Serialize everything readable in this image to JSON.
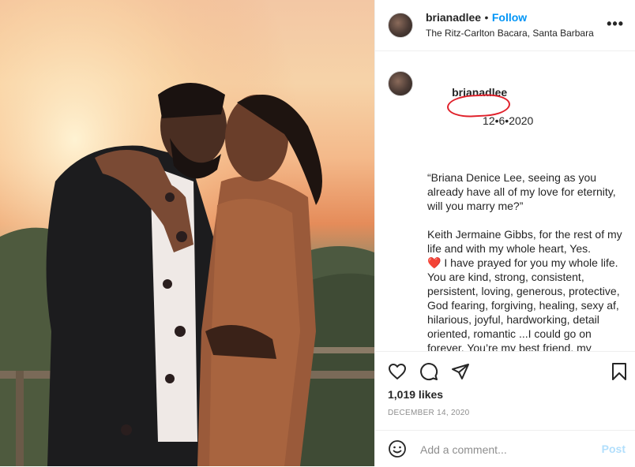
{
  "post": {
    "username": "brianadlee",
    "follow_label": "Follow",
    "separator": "•",
    "location": "The Ritz-Carlton Bacara, Santa Barbara",
    "more_icon": "more-horizontal-icon"
  },
  "caption": {
    "username": "brianadlee",
    "date_text": "12•6•2020",
    "quote": "“Briana Denice Lee, seeing as you already have all of my love for eternity, will you marry me?”",
    "body_pre_heart": "Keith Jermaine Gibbs, for the rest of my life and with my whole heart, Yes.",
    "heart_emoji": "❤️",
    "body_post_heart": " I have prayed for you my whole life. You are kind, strong, consistent, persistent, loving, generous, protective, God fearing, forgiving, healing, sexy af, hilarious, joyful, hardworking, detail oriented, romantic ...I could go on forever. You’re my best friend, my soulmate, and the one I can’t wait to come home and share everything with. In a world that’s afraid to love and truly afraid to lose, you have become my safest space where I can be loved and love wholly"
  },
  "actions": {
    "likes": "1,019 likes",
    "date": "DECEMBER 14, 2020"
  },
  "comment": {
    "placeholder": "Add a comment...",
    "post_label": "Post",
    "emoji_icon": "smiley-icon"
  },
  "colors": {
    "link_blue": "#0095f6",
    "post_disabled": "#b2dffc",
    "annotation_red": "#e0202a"
  }
}
